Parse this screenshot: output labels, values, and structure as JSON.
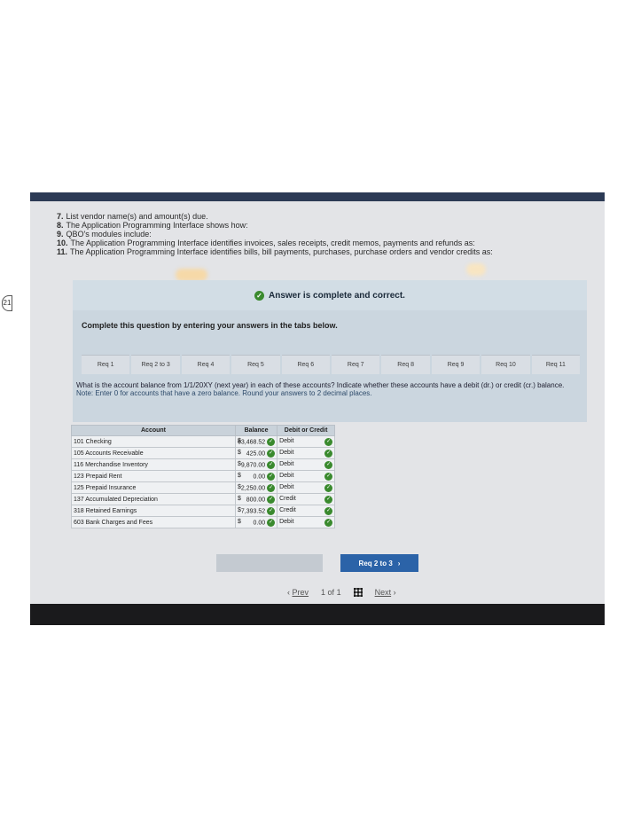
{
  "questions": [
    {
      "num": "7.",
      "text": "List vendor name(s) and amount(s) due."
    },
    {
      "num": "8.",
      "text": "The Application Programming Interface shows how:"
    },
    {
      "num": "9.",
      "text": "QBO's modules include:"
    },
    {
      "num": "10.",
      "text": "The Application Programming Interface identifies invoices, sales receipts, credit memos, payments and refunds as:"
    },
    {
      "num": "11.",
      "text": "The Application Programming Interface identifies bills, bill payments, purchases, purchase orders and vendor credits as:"
    }
  ],
  "banner": "Answer is complete and correct.",
  "instruction": "Complete this question by entering your answers in the tabs below.",
  "tabs": [
    "Req 1",
    "Req 2 to 3",
    "Req 4",
    "Req 5",
    "Req 6",
    "Req 7",
    "Req 8",
    "Req 9",
    "Req 10",
    "Req 11"
  ],
  "question": "What is the account balance from 1/1/20XY (next year) in each of these accounts? Indicate whether these accounts have a debit (dr.) or credit (cr.) balance.",
  "note": "Note: Enter 0 for accounts that have a zero balance. Round your answers to 2 decimal places.",
  "table": {
    "headers": {
      "account": "Account",
      "balance": "Balance",
      "dc": "Debit or Credit"
    },
    "rows": [
      {
        "account": "101 Checking",
        "currency": "$",
        "balance": "63,468.52",
        "dc": "Debit"
      },
      {
        "account": "105 Accounts Receivable",
        "currency": "$",
        "balance": "425.00",
        "dc": "Debit"
      },
      {
        "account": "116 Merchandise Inventory",
        "currency": "$",
        "balance": "9,870.00",
        "dc": "Debit"
      },
      {
        "account": "123 Prepaid Rent",
        "currency": "$",
        "balance": "0.00",
        "dc": "Debit"
      },
      {
        "account": "125 Prepaid Insurance",
        "currency": "$",
        "balance": "2,250.00",
        "dc": "Debit"
      },
      {
        "account": "137 Accumulated Depreciation",
        "currency": "$",
        "balance": "800.00",
        "dc": "Credit"
      },
      {
        "account": "318 Retained Earnings",
        "currency": "$",
        "balance": "7,393.52",
        "dc": "Credit"
      },
      {
        "account": "603 Bank Charges and Fees",
        "currency": "$",
        "balance": "0.00",
        "dc": "Debit"
      }
    ]
  },
  "next_tab_button": "Req 2 to 3",
  "pager": {
    "prev": "Prev",
    "page": "1",
    "of": "of",
    "total": "1",
    "next": "Next"
  },
  "side_mark": "21",
  "colors": {
    "accent": "#2b63a8",
    "check": "#3a8a2e"
  }
}
